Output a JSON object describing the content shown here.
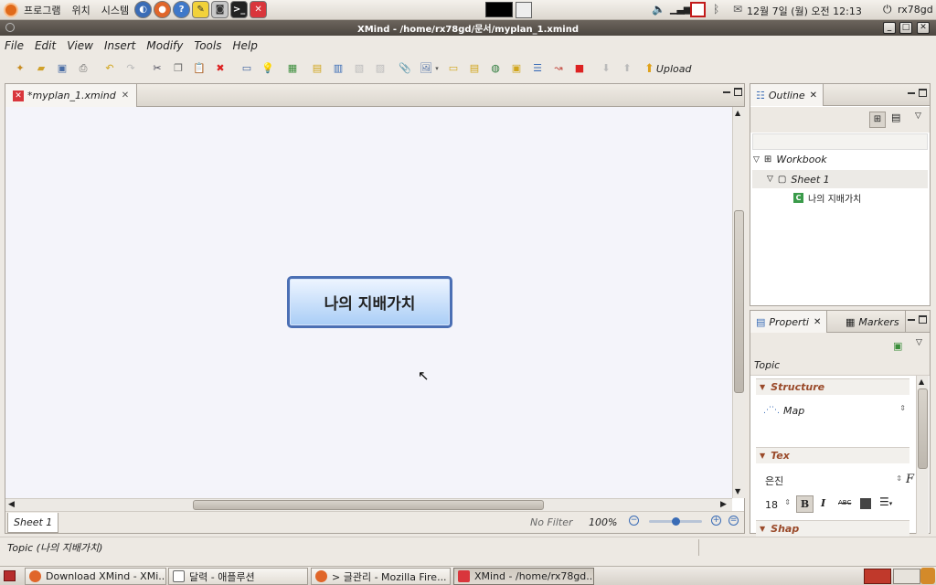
{
  "top_panel": {
    "menus": [
      "프로그램",
      "위치",
      "시스템"
    ],
    "clock": "12월 7일 (월) 오전 12:13",
    "user": "rx78gd"
  },
  "window": {
    "title": "XMind - /home/rx78gd/문서/myplan_1.xmind"
  },
  "menubar": {
    "items": [
      "File",
      "Edit",
      "View",
      "Insert",
      "Modify",
      "Tools",
      "Help"
    ]
  },
  "toolbar": {
    "upload_label": "Upload"
  },
  "editor": {
    "tab_label": "*myplan_1.xmind",
    "central_topic": "나의 지배가치",
    "sheet_tab": "Sheet 1",
    "filter": "No Filter",
    "zoom": "100%",
    "zoom_level": 0.5
  },
  "outline": {
    "tab_label": "Outline",
    "tree": [
      {
        "label": "Workbook"
      },
      {
        "label": "Sheet 1"
      },
      {
        "label": "나의 지배가치"
      }
    ]
  },
  "properties": {
    "tab_label": "Properti",
    "markers_tab": "Markers",
    "heading": "Topic",
    "structure_label": "Structure",
    "structure_value": "Map",
    "text_label": "Tex",
    "font_value": "은진",
    "font_size": "18",
    "shape_label": "Shap"
  },
  "status": {
    "text": "Topic (나의 지배가치)"
  },
  "taskbar": {
    "items": [
      "Download XMind - XMi...",
      "달력 - 애플루션",
      "> 글관리 - Mozilla Fire...",
      "XMind - /home/rx78gd..."
    ]
  },
  "colors": {
    "topic_border": "#4b6fb4",
    "topic_fill": "#a9cdf6",
    "section_title": "#9a4a2a"
  }
}
